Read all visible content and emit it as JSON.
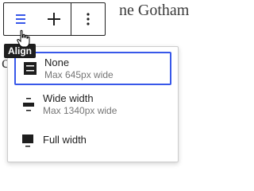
{
  "background": {
    "heading_fragment": "ne Gotham",
    "left_fragment": "c"
  },
  "toolbar": {
    "buttons": [
      {
        "name": "align-button",
        "icon": "align-none-icon"
      },
      {
        "name": "add-block-button",
        "icon": "plus-icon"
      },
      {
        "name": "options-button",
        "icon": "more-vertical-icon"
      }
    ],
    "accent": "#3858e9"
  },
  "tooltip": {
    "text": "Align"
  },
  "align_menu": {
    "options": [
      {
        "label": "None",
        "description": "Max 645px wide",
        "icon": "align-none-icon",
        "selected": true
      },
      {
        "label": "Wide width",
        "description": "Max 1340px wide",
        "icon": "align-wide-icon",
        "selected": false
      },
      {
        "label": "Full width",
        "description": "",
        "icon": "align-full-icon",
        "selected": false
      }
    ]
  }
}
